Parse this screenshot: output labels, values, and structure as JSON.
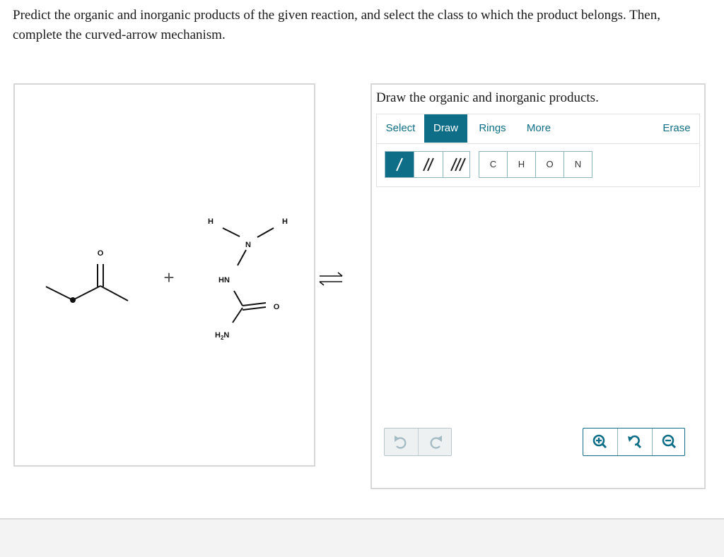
{
  "prompt": "Predict the organic and inorganic products of the given reaction, and select the class to which the product belongs. Then, complete the curved-arrow mechanism.",
  "reaction": {
    "ketone_o": "O",
    "plus": "+",
    "atom_h_left": "H",
    "atom_h_right": "H",
    "atom_n": "N",
    "atom_hn": "HN",
    "atom_h2n": "H2N",
    "atom_h2n_main": "H",
    "atom_h2n_sub": "2",
    "atom_h2n_end": "N",
    "carbonyl_o": "O",
    "equilibrium_arrow": "equilibrium-arrows"
  },
  "editor": {
    "title": "Draw the organic and inorganic products.",
    "tabs": [
      {
        "label": "Select"
      },
      {
        "label": "Draw",
        "active": true
      },
      {
        "label": "Rings"
      },
      {
        "label": "More"
      },
      {
        "label": "Erase"
      }
    ],
    "bonds": [
      "single-bond",
      "double-bond",
      "triple-bond"
    ],
    "atoms": [
      "C",
      "H",
      "O",
      "N"
    ],
    "history": [
      "undo-icon",
      "redo-icon"
    ],
    "zoom": [
      "zoom-in-icon",
      "zoom-reset-icon",
      "zoom-out-icon"
    ]
  },
  "colors": {
    "accent": "#0e6e87",
    "border": "#d7d7d7"
  }
}
